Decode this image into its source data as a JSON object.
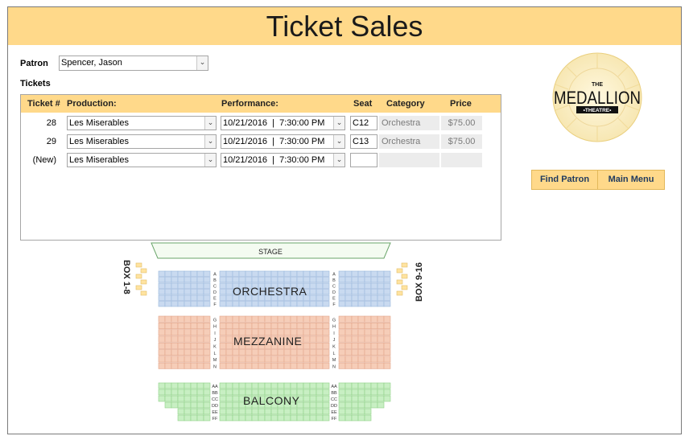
{
  "header": {
    "title": "Ticket Sales"
  },
  "patron": {
    "label": "Patron",
    "value": "Spencer, Jason"
  },
  "tickets": {
    "label": "Tickets",
    "columns": [
      "Ticket #",
      "Production:",
      "Performance:",
      "Seat",
      "Category",
      "Price"
    ],
    "rows": [
      {
        "ticket": "28",
        "production": "Les Miserables",
        "performance": "10/21/2016  |  7:30:00 PM",
        "seat": "C12",
        "category": "Orchestra",
        "price": "$75.00"
      },
      {
        "ticket": "29",
        "production": "Les Miserables",
        "performance": "10/21/2016  |  7:30:00 PM",
        "seat": "C13",
        "category": "Orchestra",
        "price": "$75.00"
      },
      {
        "ticket": "(New)",
        "production": "Les Miserables",
        "performance": "10/21/2016  |  7:30:00 PM",
        "seat": "",
        "category": "",
        "price": ""
      }
    ]
  },
  "logo": {
    "top_text": "THE",
    "main_text": "MEDALLION",
    "bottom_text": "•THEATRE•"
  },
  "buttons": {
    "find_patron": "Find Patron",
    "main_menu": "Main Menu"
  },
  "seatmap": {
    "stage": "STAGE",
    "box_left": "BOX 1-8",
    "box_right": "BOX 9-16",
    "sections": [
      "ORCHESTRA",
      "MEZZANINE",
      "BALCONY"
    ],
    "orchestra_rows": [
      "A",
      "B",
      "C",
      "D",
      "E",
      "F"
    ],
    "mezzanine_rows": [
      "G",
      "H",
      "I",
      "J",
      "K",
      "L",
      "M",
      "N"
    ],
    "balcony_rows": [
      "AA",
      "BB",
      "CC",
      "DD",
      "EE",
      "FF"
    ]
  },
  "colors": {
    "accent": "#ffd98a",
    "orchestra": "#c9daf0",
    "mezzanine": "#f6cdb8",
    "balcony": "#c8efc3",
    "box": "#ffe3a0"
  }
}
